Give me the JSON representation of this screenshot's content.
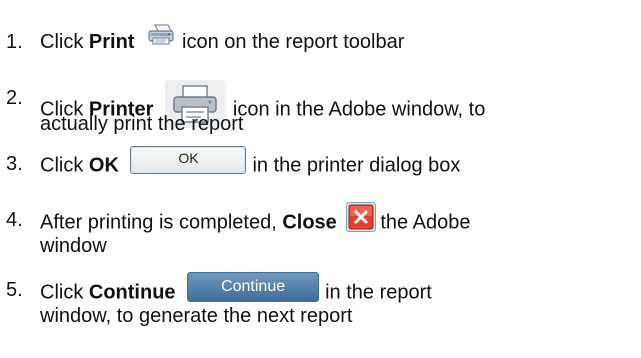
{
  "steps": [
    {
      "number": "1.",
      "prefix": "Click ",
      "bold": "Print",
      "icon": "print-toolbar-icon",
      "suffix": "icon on the report toolbar"
    },
    {
      "number": "2.",
      "prefix": "Click ",
      "bold": "Printer",
      "icon": "printer-icon",
      "suffix": "icon in the Adobe window, to",
      "continuation": "actually print the report"
    },
    {
      "number": "3.",
      "prefix": "Click ",
      "bold": "OK",
      "button_label": "OK",
      "suffix": "in the printer dialog box"
    },
    {
      "number": "4.",
      "prefix": "After printing is completed, ",
      "bold": "Close",
      "icon": "close-x-icon",
      "suffix": "the Adobe",
      "continuation": "window"
    },
    {
      "number": "5.",
      "prefix": "Click ",
      "bold": "Continue",
      "button_label": "Continue",
      "suffix": "in the report",
      "continuation": "window, to generate the next report"
    }
  ],
  "colors": {
    "text": "#111111",
    "close_icon_red": "#e0412f",
    "continue_button": "#4f7ea8"
  }
}
